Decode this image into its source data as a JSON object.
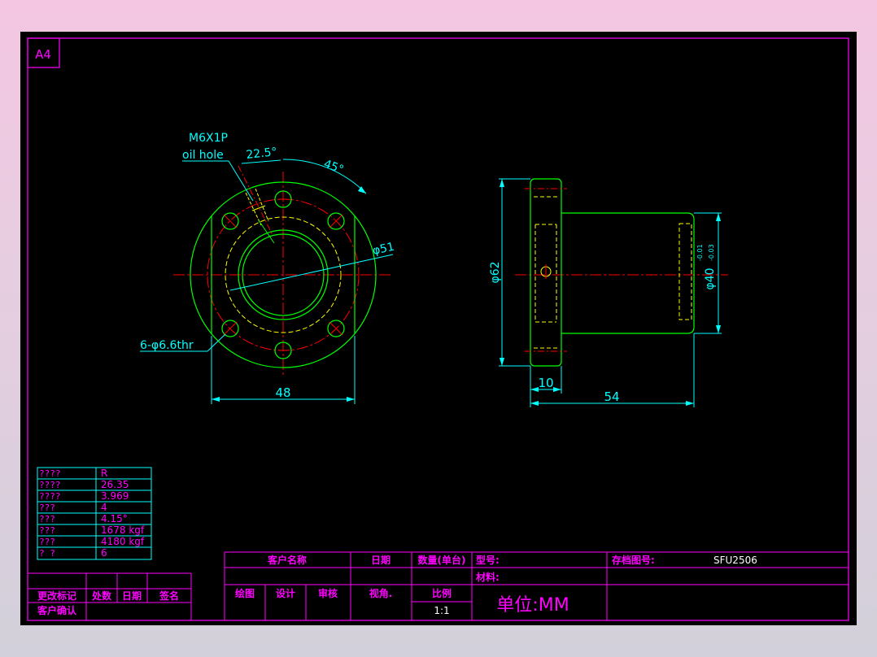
{
  "sheet": {
    "size_label": "A4"
  },
  "front_view": {
    "oil_hole_label": "M6X1P",
    "oil_hole_sub": "oil hole",
    "angle_1": "22.5°",
    "angle_2": "45°",
    "pcd_label": "φ51",
    "holes_label": "6-φ6.6thr",
    "width_label": "48"
  },
  "side_view": {
    "flange_dia_label": "φ62",
    "body_dia_label": "φ40",
    "tol_upper": "-0.01",
    "tol_lower": "-0.03",
    "flange_thk_label": "10",
    "length_label": "54"
  },
  "spec_table": {
    "rows": [
      {
        "name": "????",
        "value": "R"
      },
      {
        "name": "????",
        "value": "26.35"
      },
      {
        "name": "????",
        "value": "3.969"
      },
      {
        "name": " ???",
        "value": "4"
      },
      {
        "name": " ???",
        "value": "4.15°"
      },
      {
        "name": " ???",
        "value": "1678 kgf"
      },
      {
        "name": " ???",
        "value": "4180 kgf"
      },
      {
        "name": "?  ?",
        "value": "6"
      }
    ]
  },
  "title_block": {
    "customer_name": "客户名称",
    "date": "日期",
    "quantity": "数量(单台)",
    "model": "型号:",
    "drawing_no_label": "存档图号:",
    "drawing_no": "SFU2506",
    "material": "材料:",
    "drawn": "绘图",
    "design": "设计",
    "check": "审核",
    "view_angle": "视角.",
    "scale_label": "比例",
    "scale": "1:1",
    "unit": "单位:MM"
  },
  "revision_block": {
    "change_mark": "更改标记",
    "count": "处数",
    "date": "日期",
    "sign": "签名",
    "customer_confirm": "客户确认"
  },
  "colors": {
    "frame": "#ff00ff",
    "outline": "#00ff00",
    "hidden": "#ffff00",
    "center": "#ff0000",
    "dimension": "#00ffff",
    "text": "#ffffff",
    "yellow_text": "#ffff00"
  }
}
